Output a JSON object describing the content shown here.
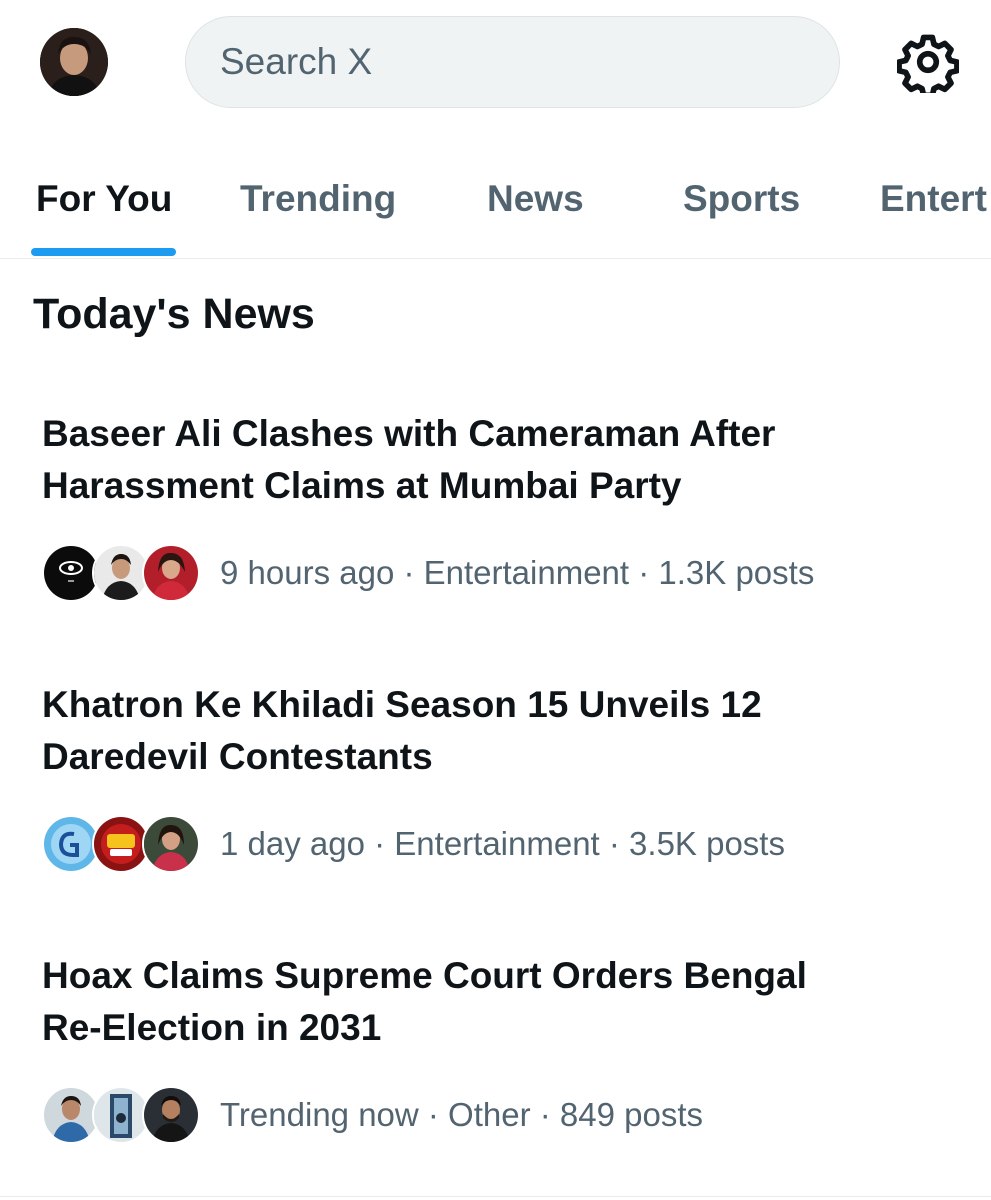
{
  "header": {
    "search_placeholder": "Search X",
    "settings_icon": "gear-icon"
  },
  "tabs": [
    {
      "label": "For You",
      "active": true
    },
    {
      "label": "Trending",
      "active": false
    },
    {
      "label": "News",
      "active": false
    },
    {
      "label": "Sports",
      "active": false
    },
    {
      "label": "Entert",
      "active": false
    }
  ],
  "section": {
    "title": "Today's News"
  },
  "news": [
    {
      "headline": "Baseer Ali Clashes with Cameraman After Harassment Claims at Mumbai Party",
      "meta": "9 hours ago · Entertainment · 1.3K posts"
    },
    {
      "headline": "Khatron Ke Khiladi Season 15 Unveils 12 Daredevil Contestants",
      "meta": "1 day ago · Entertainment · 3.5K posts"
    },
    {
      "headline": "Hoax Claims Supreme Court Orders Bengal Re-Election in 2031",
      "meta": "Trending now · Other · 849 posts"
    }
  ],
  "colors": {
    "accent": "#1d9bf0",
    "text_primary": "#0f1419",
    "text_secondary": "#536471",
    "search_bg": "#eff3f4"
  }
}
